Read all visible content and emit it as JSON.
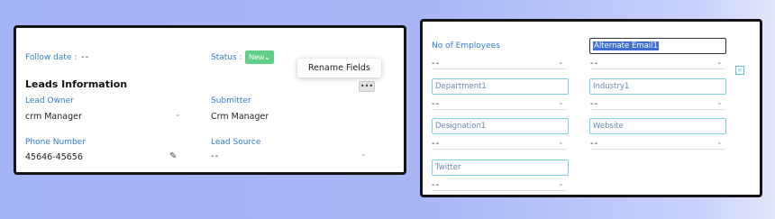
{
  "left": {
    "follow_date_label": "Follow date :",
    "follow_date_value": "--",
    "status_label": "Status :",
    "status_value": "New",
    "rename_fields": "Rename Fields",
    "more_label": "•••",
    "section_title": "Leads Information",
    "lead_owner_label": "Lead Owner",
    "lead_owner_value": "crm Manager",
    "submitter_label": "Submitter",
    "submitter_value": "Crm Manager",
    "phone_label": "Phone Number",
    "phone_value": "45646-45656",
    "lead_source_label": "Lead Source",
    "lead_source_value": "--"
  },
  "right": {
    "employees_label": "No of Employees",
    "employees_value": "--",
    "alternate_email_value": "Alternate Email1",
    "alternate_email_dropdown": "--",
    "department_value": "Department1",
    "department_dropdown": "--",
    "industry_value": "Industry1",
    "industry_dropdown": "--",
    "designation_value": "Designation1",
    "designation_dropdown": "--",
    "website_value": "Website",
    "website_dropdown": "--",
    "twitter_value": "Twitter",
    "twitter_dropdown": "--",
    "close_icon_glyph": "×"
  },
  "icons": {
    "chevron": "⌄",
    "edit": "✎"
  }
}
